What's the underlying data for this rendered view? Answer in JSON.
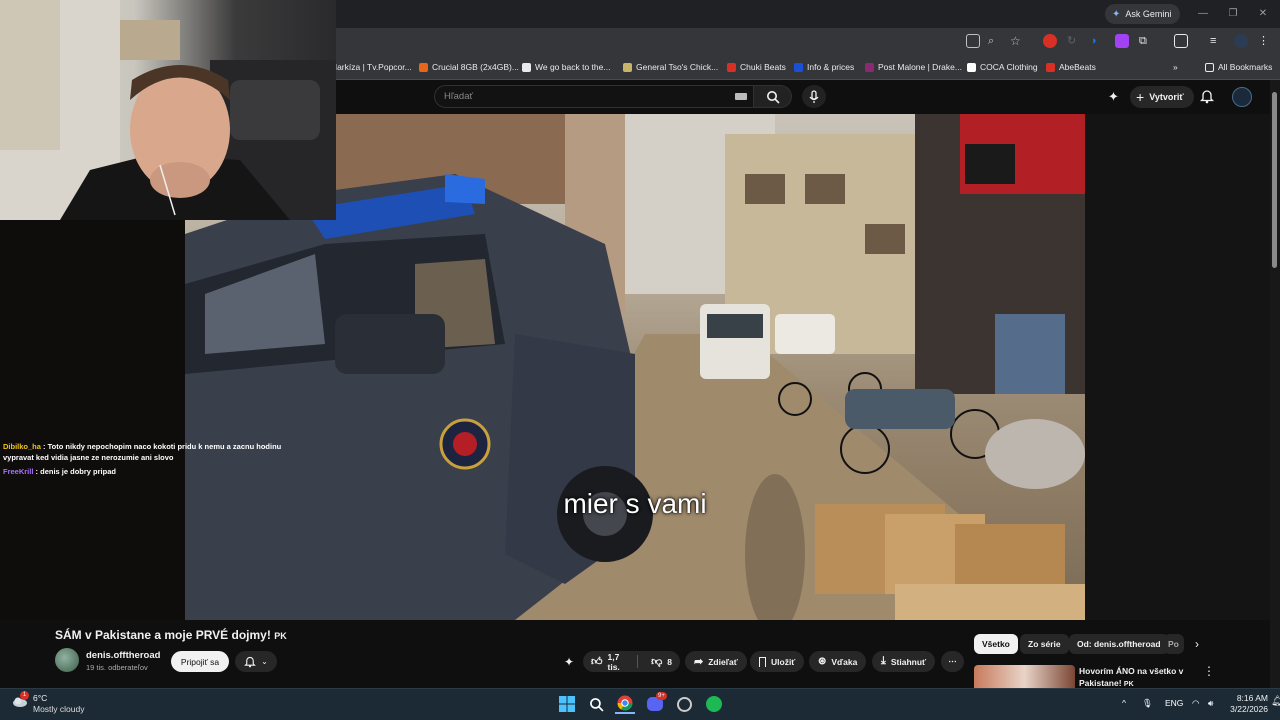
{
  "browser": {
    "ask_gemini": "Ask Gemini",
    "bookmarks": [
      {
        "label": "Markíza | Tv.Popcor...",
        "color": "#2b3d52"
      },
      {
        "label": "Crucial 8GB (2x4GB)...",
        "color": "#e8661a"
      },
      {
        "label": "We go back to the...",
        "color": "#e8eaed"
      },
      {
        "label": "General Tso's Chick...",
        "color": "#c9b36b"
      },
      {
        "label": "Chuki Beats",
        "color": "#d93025"
      },
      {
        "label": "Info & prices",
        "color": "#1a4fd6"
      },
      {
        "label": "Post Malone | Drake...",
        "color": "#8a2a72"
      },
      {
        "label": "COCA Clothing",
        "color": "#ffffff"
      },
      {
        "label": "AbeBeats",
        "color": "#d93025"
      }
    ],
    "all_bookmarks": "All Bookmarks"
  },
  "youtube": {
    "search_placeholder": "Hľadať",
    "create_label": "Vytvoriť",
    "subtitle": "mier s vami",
    "video_title": "SÁM v Pakistane a moje PRVÉ dojmy!",
    "title_flag": "PK",
    "channel": {
      "name": "denis.offtheroad",
      "subscribers": "19 tis. odberateľov",
      "join_label": "Pripojiť sa"
    },
    "actions": {
      "likes": "1,7 tis.",
      "dislikes": "8",
      "share": "Zdieľať",
      "save": "Uložiť",
      "thanks": "Vďaka",
      "download": "Stiahnuť"
    },
    "chips": [
      "Všetko",
      "Zo série",
      "Od: denis.offtheroad",
      "Po"
    ],
    "recommended": {
      "title": "Hovorím ÁNO na všetko v Pakistane!",
      "flag": "PK"
    }
  },
  "chat": [
    {
      "user": "Dibilko_ha",
      "color": "#f0c419",
      "message": "Toto nikdy nepochopim naco kokoti pridu k nemu a zacnu hodinu vypravat ked vidia jasne ze nerozumie ani slovo"
    },
    {
      "user": "FreeKrill",
      "color": "#a970ff",
      "message": "denis je dobry pripad"
    }
  ],
  "taskbar": {
    "weather_temp": "6°C",
    "weather_desc": "Mostly cloudy",
    "weather_badge": "1",
    "language": "ENG",
    "time": "8:16 AM",
    "date": "3/22/2026",
    "discord_badge": "9+"
  }
}
